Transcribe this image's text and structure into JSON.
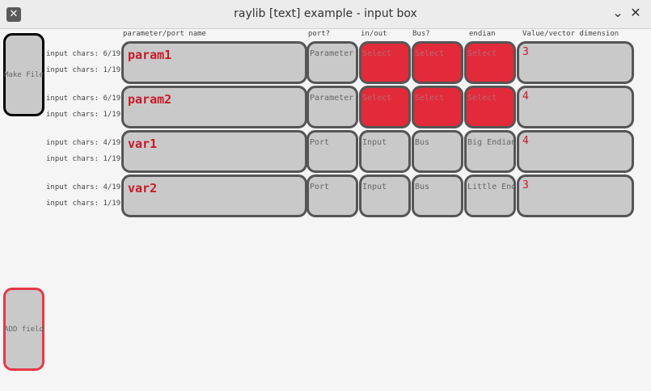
{
  "window": {
    "title": "raylib [text] example - input box"
  },
  "headers": {
    "name": "parameter/port name",
    "port": "port?",
    "inout": "in/out",
    "bus": "Bus?",
    "endian": "endian",
    "value": "Value/vector dimension"
  },
  "buttons": {
    "make_file": "Make File",
    "add_field": "ADD field"
  },
  "colors": {
    "accent_red": "#e32a3a",
    "cell_bg": "#c9c9c9",
    "text_red": "#c81a2a"
  },
  "rows": [
    {
      "chars1": "input chars: 6/19",
      "chars2": "input chars: 1/19",
      "name": "param1",
      "port": "Parameter",
      "inout": "Select",
      "bus": "Select",
      "endian": "Select",
      "value": "3"
    },
    {
      "chars1": "input chars: 6/19",
      "chars2": "input chars: 1/19",
      "name": "param2",
      "port": "Parameter",
      "inout": "Select",
      "bus": "Select",
      "endian": "Select",
      "value": "4"
    },
    {
      "chars1": "input chars: 4/19",
      "chars2": "input chars: 1/19",
      "name": "var1",
      "port": "Port",
      "inout": "Input",
      "bus": "Bus",
      "endian": "Big Endian",
      "value": "4"
    },
    {
      "chars1": "input chars: 4/19",
      "chars2": "input chars: 1/19",
      "name": "var2",
      "port": "Port",
      "inout": "Input",
      "bus": "Bus",
      "endian": "Little Endian",
      "value": "3"
    }
  ]
}
